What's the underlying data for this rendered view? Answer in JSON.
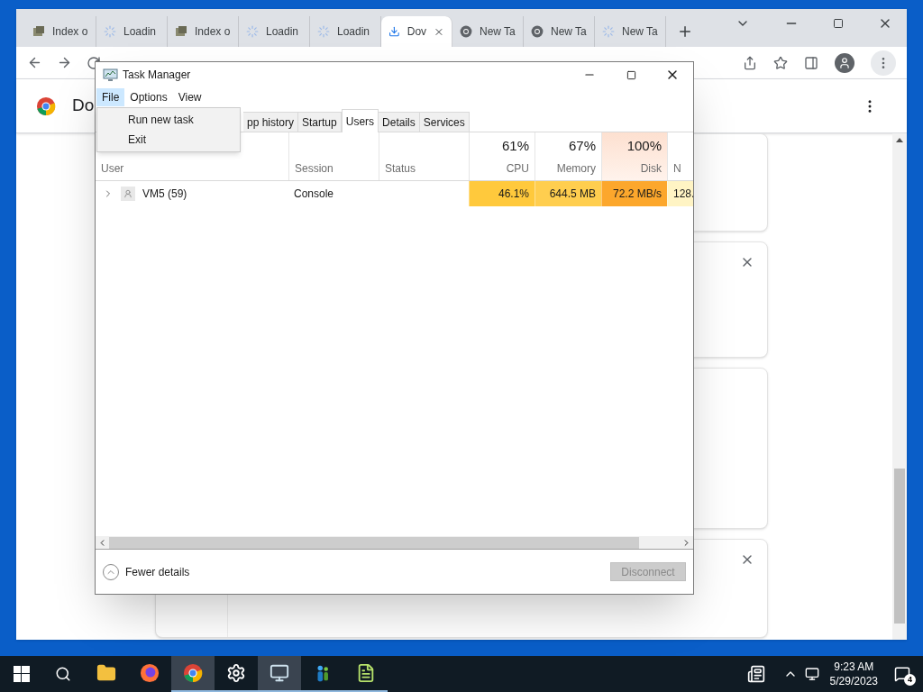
{
  "browser": {
    "tabs": [
      {
        "title": "Index o",
        "kind": "page",
        "selected": false
      },
      {
        "title": "Loadin",
        "kind": "loading",
        "selected": false
      },
      {
        "title": "Index o",
        "kind": "page",
        "selected": false
      },
      {
        "title": "Loadin",
        "kind": "loading",
        "selected": false
      },
      {
        "title": "Loadin",
        "kind": "loading",
        "selected": false
      },
      {
        "title": "Dov",
        "kind": "download",
        "selected": true
      },
      {
        "title": "New Ta",
        "kind": "chrome",
        "selected": false
      },
      {
        "title": "New Ta",
        "kind": "chrome",
        "selected": false
      },
      {
        "title": "New Ta",
        "kind": "loading",
        "selected": false
      }
    ],
    "page_title": "Do",
    "cards": [
      {
        "closable": false
      },
      {
        "closable": true
      },
      {
        "closable": false
      },
      {
        "closable": true
      }
    ]
  },
  "task_manager": {
    "title": "Task Manager",
    "menu": [
      {
        "label": "File",
        "selected": true
      },
      {
        "label": "Options",
        "selected": false
      },
      {
        "label": "View",
        "selected": false
      }
    ],
    "file_menu": [
      "Run new task",
      "Exit"
    ],
    "tabs": [
      {
        "label": "pp history",
        "selected": false
      },
      {
        "label": "Startup",
        "selected": false
      },
      {
        "label": "Users",
        "selected": true
      },
      {
        "label": "Details",
        "selected": false
      },
      {
        "label": "Services",
        "selected": false
      }
    ],
    "columns": [
      {
        "label": "User",
        "highlighted": false
      },
      {
        "label": "Session",
        "highlighted": false
      },
      {
        "label": "Status",
        "highlighted": false
      },
      {
        "percent": "61%",
        "label": "CPU",
        "highlighted": false
      },
      {
        "percent": "67%",
        "label": "Memory",
        "highlighted": false
      },
      {
        "percent": "100%",
        "label": "Disk",
        "highlighted": true
      },
      {
        "label": "N",
        "highlighted": false
      }
    ],
    "rows": [
      {
        "expanded": false,
        "cells": [
          {
            "value": "VM5 (59)"
          },
          {
            "value": "Console"
          },
          {},
          {
            "value": "46.1%",
            "color": "#ffc93c"
          },
          {
            "value": "644.5 MB",
            "color": "#ffce4f"
          },
          {
            "value": "72.2 MB/s",
            "color": "#fca72c"
          },
          {
            "value": "128.",
            "color": "#fff4c4"
          }
        ]
      }
    ],
    "footer": {
      "toggle": "Fewer details",
      "button": {
        "label": "Disconnect",
        "disabled": true
      }
    }
  },
  "taskbar": {
    "apps": [
      {
        "kind": "folder",
        "running": false,
        "selected": false
      },
      {
        "kind": "firefox",
        "running": false,
        "selected": false
      },
      {
        "kind": "chrome",
        "running": true,
        "selected": true
      },
      {
        "kind": "gear",
        "running": true,
        "selected": false
      },
      {
        "kind": "monitor",
        "running": true,
        "selected": true
      },
      {
        "kind": "people",
        "running": true,
        "selected": false
      },
      {
        "kind": "notepad",
        "running": true,
        "selected": false
      }
    ],
    "time": "9:23 AM",
    "date": "5/29/2023",
    "notifications": "4"
  }
}
